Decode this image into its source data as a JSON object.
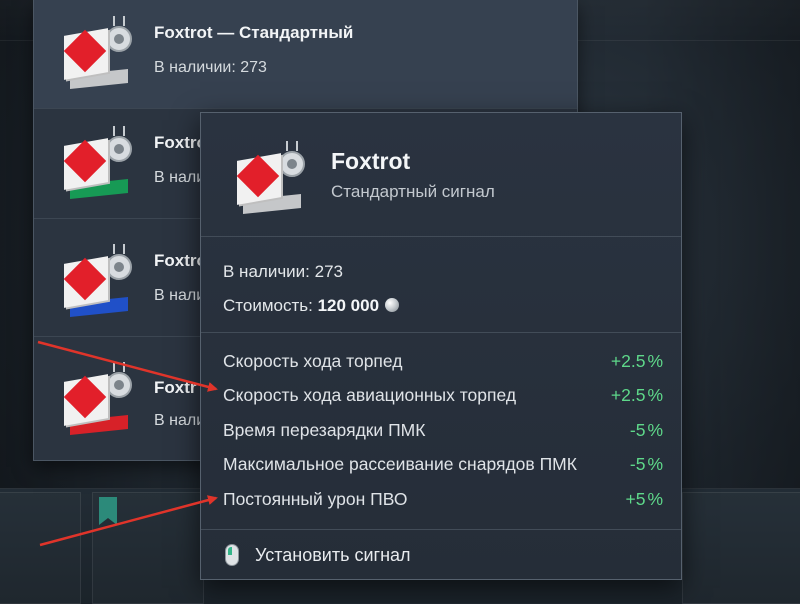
{
  "list": {
    "items": [
      {
        "title": "Foxtrot — Стандартный",
        "subtitle": "В наличии: 273",
        "band": "grey"
      },
      {
        "title": "Foxtrot",
        "subtitle": "В нали",
        "band": "green"
      },
      {
        "title": "Foxtrot",
        "subtitle": "В нали",
        "band": "blue"
      },
      {
        "title": "Foxtr",
        "subtitle": "В нали",
        "band": "red"
      }
    ]
  },
  "tooltip": {
    "name": "Foxtrot",
    "type": "Стандартный сигнал",
    "stock_label": "В наличии:",
    "stock_value": "273",
    "cost_label": "Стоимость:",
    "cost_value": "120 000",
    "cost_icon": "silver-coin-icon",
    "modifiers": [
      {
        "name": "Скорость хода торпед",
        "value": "+2.5",
        "unit": "%"
      },
      {
        "name": "Скорость хода авиационных торпед",
        "value": "+2.5",
        "unit": "%"
      },
      {
        "name": "Время перезарядки ПМК",
        "value": "-5",
        "unit": "%"
      },
      {
        "name": "Максимальное рассеивание снарядов ПМК",
        "value": "-5",
        "unit": "%"
      },
      {
        "name": "Постоянный урон ПВО",
        "value": "+5",
        "unit": "%"
      }
    ],
    "action_icon": "mouse-left-click-icon",
    "action_label": "Установить сигнал"
  },
  "colors": {
    "positive": "#5ed88a",
    "annotation_arrow": "#e0342a",
    "flag_red": "#e21f2a"
  }
}
